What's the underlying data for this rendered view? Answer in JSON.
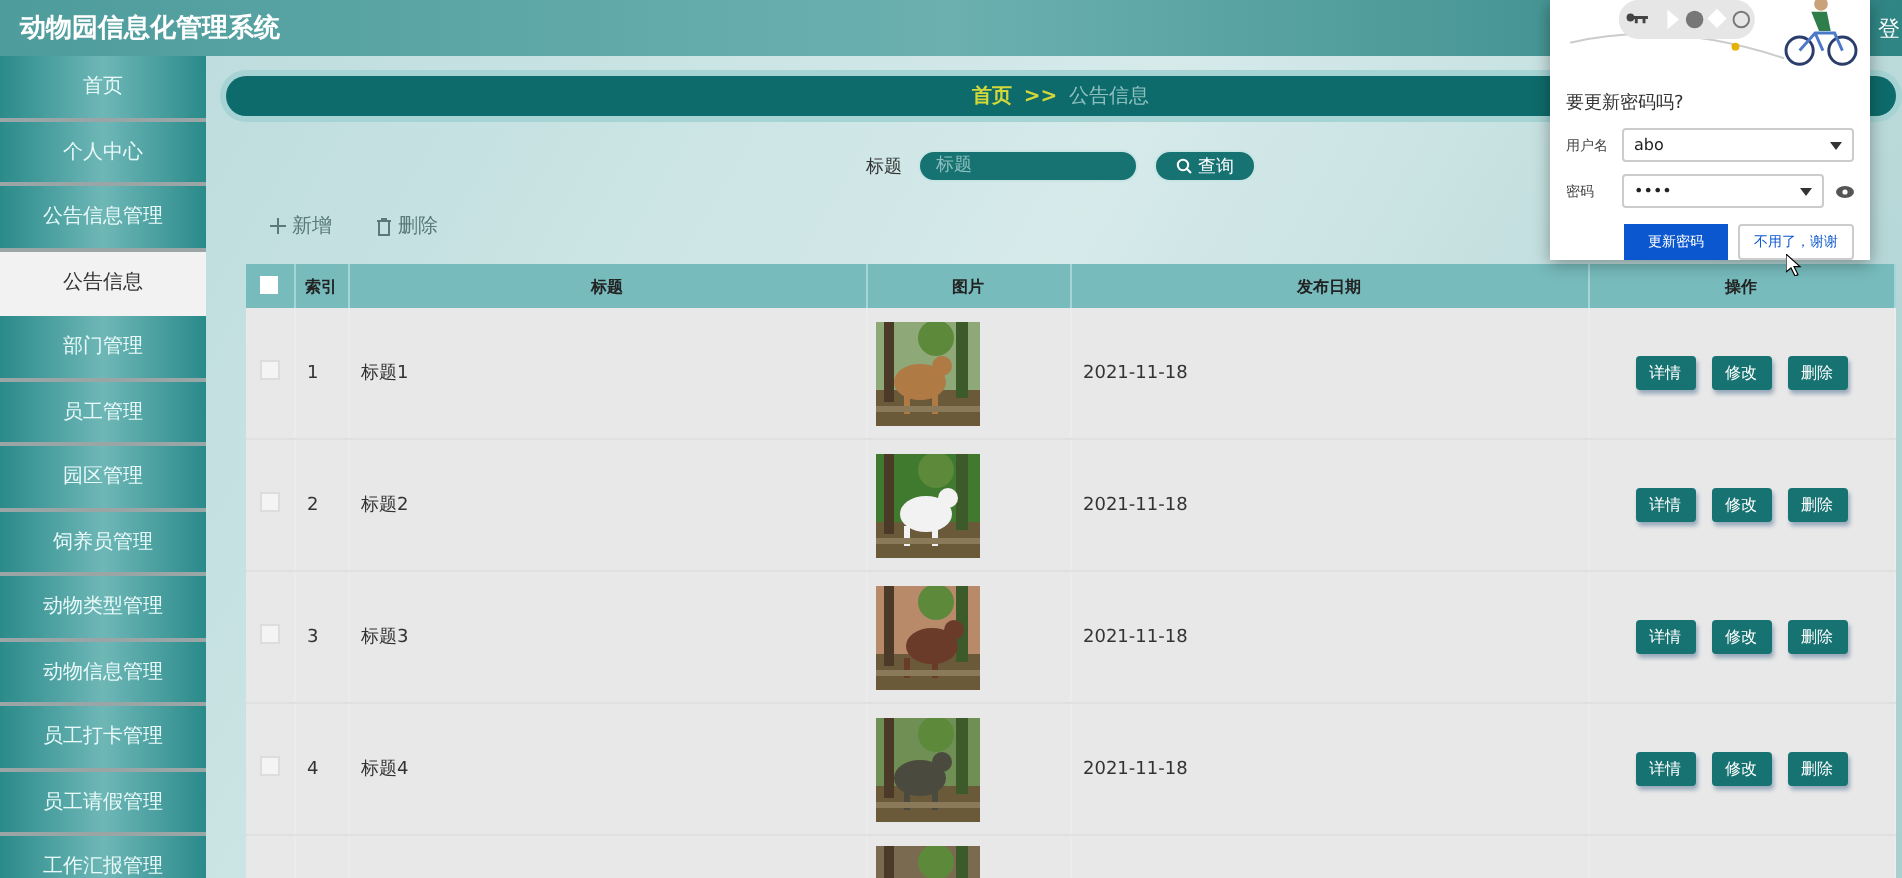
{
  "header": {
    "title": "动物园信息化管理系统",
    "user_link": "登"
  },
  "sidebar": {
    "items": [
      {
        "label": "首页",
        "selected": false
      },
      {
        "label": "个人中心",
        "selected": false
      },
      {
        "label": "公告信息管理",
        "selected": false
      },
      {
        "label": "公告信息",
        "selected": true
      },
      {
        "label": "部门管理",
        "selected": false
      },
      {
        "label": "员工管理",
        "selected": false
      },
      {
        "label": "园区管理",
        "selected": false
      },
      {
        "label": "饲养员管理",
        "selected": false
      },
      {
        "label": "动物类型管理",
        "selected": false
      },
      {
        "label": "动物信息管理",
        "selected": false
      },
      {
        "label": "员工打卡管理",
        "selected": false
      },
      {
        "label": "员工请假管理",
        "selected": false
      },
      {
        "label": "工作汇报管理",
        "selected": false
      }
    ]
  },
  "breadcrumb": {
    "home": "首页",
    "separator": ">>",
    "current": "公告信息"
  },
  "search": {
    "label": "标题",
    "placeholder": "标题",
    "button": "查询"
  },
  "actions": {
    "add": "新增",
    "delete": "删除"
  },
  "table": {
    "columns": [
      "索引",
      "标题",
      "图片",
      "发布日期",
      "操作"
    ],
    "header_checked": false,
    "rows": [
      {
        "checked": false,
        "index": "1",
        "title": "标题1",
        "image": {
          "kind": "picture"
        },
        "date": "2021-11-18",
        "buttons": [
          "详情",
          "修改",
          "删除"
        ]
      },
      {
        "checked": false,
        "index": "2",
        "title": "标题2",
        "image": {
          "kind": "picture"
        },
        "date": "2021-11-18",
        "buttons": [
          "详情",
          "修改",
          "删除"
        ]
      },
      {
        "checked": false,
        "index": "3",
        "title": "标题3",
        "image": {
          "kind": "picture"
        },
        "date": "2021-11-18",
        "buttons": [
          "详情",
          "修改",
          "删除"
        ]
      },
      {
        "checked": false,
        "index": "4",
        "title": "标题4",
        "image": {
          "kind": "picture"
        },
        "date": "2021-11-18",
        "buttons": [
          "详情",
          "修改",
          "删除"
        ]
      },
      {
        "image": {
          "kind": "picture"
        }
      }
    ]
  },
  "password_popup": {
    "title": "要更新密码吗?",
    "username_label": "用户名",
    "username": "abo",
    "password_label": "密码",
    "password": "••••",
    "primary_button": "更新密码",
    "secondary_button": "不用了，谢谢"
  }
}
